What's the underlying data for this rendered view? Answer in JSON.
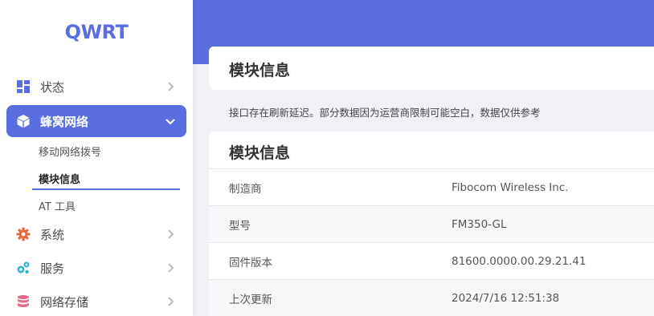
{
  "app": {
    "logo": "QWRT"
  },
  "sidebar": {
    "items": [
      {
        "label": "状态",
        "icon": "dashboard-grid-icon"
      },
      {
        "label": "蜂窝网络",
        "icon": "cube-icon",
        "active": true
      },
      {
        "label": "系统",
        "icon": "gear-icon"
      },
      {
        "label": "服务",
        "icon": "gears-icon"
      },
      {
        "label": "网络存储",
        "icon": "database-icon"
      }
    ],
    "sub_items": [
      {
        "label": "移动网络拨号"
      },
      {
        "label": "模块信息",
        "active": true
      },
      {
        "label": "AT 工具"
      }
    ]
  },
  "page": {
    "title": "模块信息",
    "notice": "接口存在刷新延迟。部分数据因为运营商限制可能空白，数据仅供参考"
  },
  "info_card": {
    "title": "模块信息",
    "rows": [
      {
        "key": "制造商",
        "value": "Fibocom Wireless Inc."
      },
      {
        "key": "型号",
        "value": "FM350-GL"
      },
      {
        "key": "固件版本",
        "value": "81600.0000.00.29.21.41"
      },
      {
        "key": "上次更新",
        "value": "2024/7/16 12:51:38"
      }
    ]
  },
  "colors": {
    "accent": "#5b6ee1",
    "background": "#f0f1f7",
    "gear": "#e8693a",
    "gears": "#2fb5c9",
    "database": "#e06a8a"
  }
}
